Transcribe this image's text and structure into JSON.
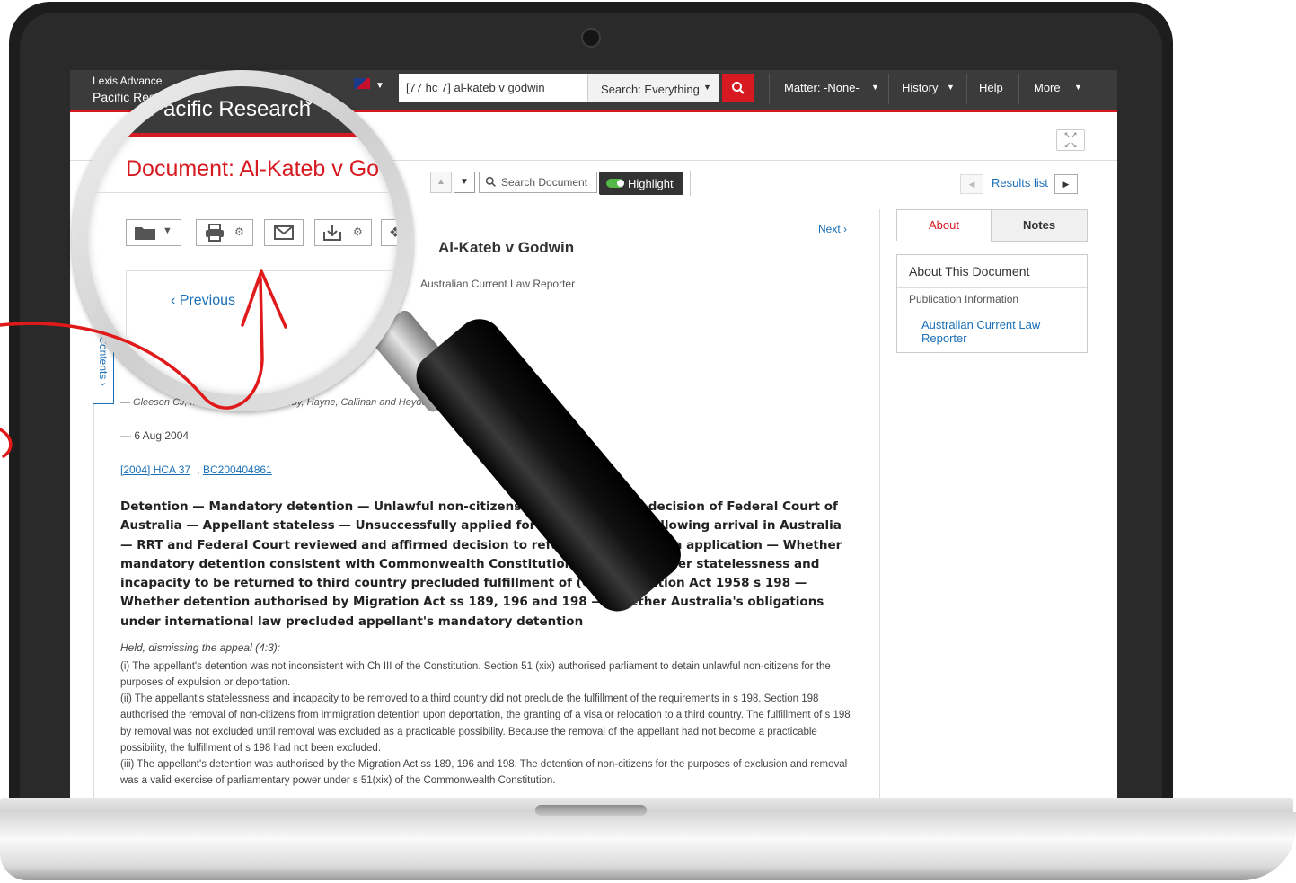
{
  "app": {
    "brand_line1": "Lexis Advance",
    "brand_line2": "Pacific Research",
    "brand_mark": "®"
  },
  "topbar": {
    "search_value": "[77 hc 7] al-kateb v godwin",
    "search_scope": "Search: Everything",
    "nav": {
      "matter": "Matter: -None-",
      "history": "History",
      "help": "Help",
      "more": "More"
    }
  },
  "toolbar": {
    "search_document": "Search Document",
    "highlight": "Highlight",
    "results_list": "Results list"
  },
  "document": {
    "next": "Next",
    "title": "Al-Kateb v Godwin",
    "heading_prefix": "Document: Al-Kateb v Go",
    "source": "Australian Current Law Reporter",
    "toc": "Contents",
    "previous": "Previous",
    "judges": "— Gleeson CJ, McHugh, Gummow, Kirby, Hayne, Callinan and Heydon JJ",
    "date": "— 6 Aug 2004",
    "citation_1": "[2004] HCA 37",
    "citation_sep": ",",
    "citation_2": "BC200404861",
    "catchwords": "Detention — Mandatory detention — Unlawful non-citizens — Appeal against decision of Federal Court of Australia — Appellant stateless — Unsuccessfully applied for protection visa following arrival in Australia — RRT and Federal Court reviewed and affirmed decision to refuse protection visa application — Whether mandatory detention consistent with Commonwealth Constitution Ch III — Whether statelessness and incapacity to be returned to third country precluded fulfillment of (CTH) Migration Act 1958 s 198 — Whether detention authorised by Migration Act ss 189, 196 and 198 — Whether Australia's obligations under international law precluded appellant's mandatory detention",
    "held_intro": "Held, dismissing the appeal (4:3):",
    "held_1": "(i) The appellant's detention was not inconsistent with Ch III of the Constitution. Section 51 (xix) authorised parliament to detain unlawful non-citizens for the purposes of expulsion or deportation.",
    "held_2": "(ii) The appellant's statelessness and incapacity to be removed to a third country did not preclude the fulfillment of the requirements in s 198. Section 198 authorised the removal of non-citizens from immigration detention upon deportation, the granting of a visa or relocation to a third country. The fulfillment of s 198 by removal was not excluded until removal was excluded as a practicable possibility. Because the removal of the appellant had not become a practicable possibility, the fulfillment of s 198 had not been excluded.",
    "held_3": "(iii) The appellant's detention was authorised by the Migration Act ss 189, 196 and 198. The detention of non-citizens for the purposes of exclusion and removal was a valid exercise of parliamentary power under s 51(xix) of the Commonwealth Constitution."
  },
  "side_panel": {
    "tab_about": "About",
    "tab_notes": "Notes",
    "heading": "About This Document",
    "publication_label": "Publication Information",
    "publication_link": "Australian Current Law Reporter"
  },
  "icons": [
    "search-icon",
    "folder-icon",
    "print-icon",
    "email-icon",
    "download-icon",
    "dropbox-icon",
    "gear-icon",
    "expand-icon",
    "chevron-down-icon"
  ],
  "colors": {
    "accent_red": "#d71921",
    "link_blue": "#1a6fb6",
    "topbar_dark": "#3b3b3b",
    "toggle_green": "#55b948"
  }
}
